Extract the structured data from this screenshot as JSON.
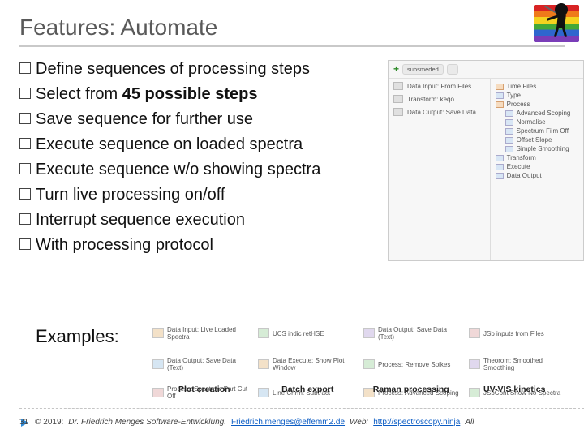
{
  "title": "Features: Automate",
  "bullets": [
    "Define sequences of processing steps",
    [
      "Select from ",
      "45 possible steps"
    ],
    "Save sequence for further use",
    "Execute sequence on loaded spectra",
    "Execute sequence w/o showing spectra",
    "Turn live processing on/off",
    "Interrupt sequence execution",
    "With processing protocol"
  ],
  "examples_label": "Examples:",
  "side_screenshot": {
    "tab_label": "subsmeded",
    "left_items": [
      "Data Input: From Files",
      "Transform: keqo",
      "Data Output: Save Data"
    ],
    "right_tree": [
      "Time Files",
      "Type",
      "Process",
      "Advanced Scoping",
      "Normalise",
      "Spectrum Film Off",
      "Offset Slope",
      "Simple Smoothing",
      "Transform",
      "Execute",
      "Data Output"
    ]
  },
  "example_items": [
    "Data Input: Live Loaded Spectra",
    "UCS indic retHSE",
    "Data Output: Save Data (Text)",
    "JSb inputs from Files",
    "Data Output: Save Data (Text)",
    "Data Execute: Show Plot Window",
    "Process: Remove Spikes",
    "Theorom: Smoothed Smoothing",
    "Process: Spectrum Part Cut Off",
    "Line Chrm: Subtract",
    "Process: Advanced Scoping",
    "JSbCont Show No Spectra"
  ],
  "captions": [
    "Plot creation",
    "Batch export",
    "Raman processing",
    "UV-VIS kinetics"
  ],
  "footer": {
    "slide_num": "31",
    "copyright": "© 2019:",
    "author": "Dr. Friedrich Menges Software-Entwicklung.",
    "email": "Friedrich.menges@effemm2.de",
    "web_label": "Web:",
    "web_url": "http://spectroscopy.ninja",
    "trail": "All"
  }
}
